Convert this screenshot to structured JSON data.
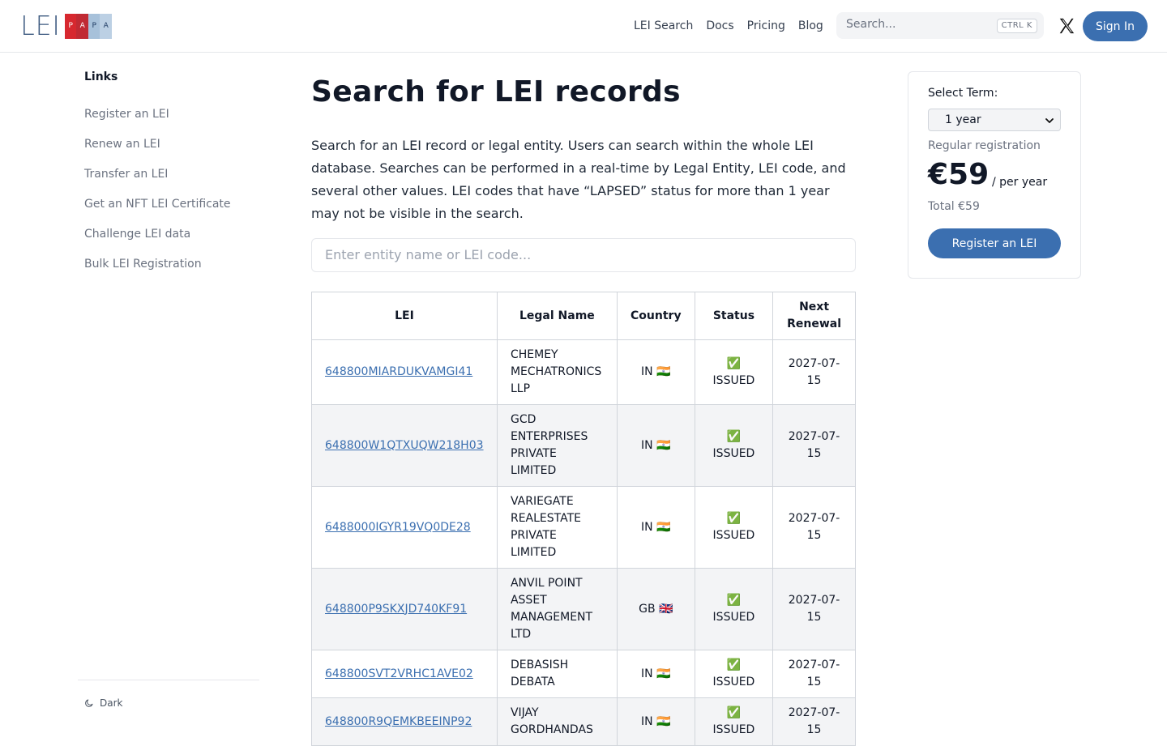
{
  "header": {
    "logo": {
      "text": "LEI",
      "letters": [
        "P",
        "A",
        "P",
        "A"
      ]
    },
    "nav": [
      "LEI Search",
      "Docs",
      "Pricing",
      "Blog"
    ],
    "search": {
      "placeholder": "Search...",
      "shortcut": "CTRL K"
    },
    "signin_label": "Sign In"
  },
  "sidebar": {
    "title": "Links",
    "items": [
      "Register an LEI",
      "Renew an LEI",
      "Transfer an LEI",
      "Get an NFT LEI Certificate",
      "Challenge LEI data",
      "Bulk LEI Registration"
    ],
    "theme_toggle": "Dark"
  },
  "main": {
    "title": "Search for LEI records",
    "intro": "Search for an LEI record or legal entity. Users can search within the whole LEI database. Searches can be performed in a real-time by Legal Entity, LEI code, and several other values. LEI codes that have “LAPSED” status for more than 1 year may not be visible in the search.",
    "entity_search_placeholder": "Enter entity name or LEI code...",
    "table": {
      "headers": [
        "LEI",
        "Legal Name",
        "Country",
        "Status",
        "Next Renewal"
      ],
      "rows": [
        {
          "lei": "648800MIARDUKVAMGI41",
          "name": "CHEMEY MECHATRONICS LLP",
          "country": "IN 🇮🇳",
          "status": "✅ ISSUED",
          "renewal": "2027-07-15"
        },
        {
          "lei": "648800W1QTXUQW218H03",
          "name": "GCD ENTERPRISES PRIVATE LIMITED",
          "country": "IN 🇮🇳",
          "status": "✅ ISSUED",
          "renewal": "2027-07-15"
        },
        {
          "lei": "6488000IGYR19VQ0DE28",
          "name": "VARIEGATE REALESTATE PRIVATE LIMITED",
          "country": "IN 🇮🇳",
          "status": "✅ ISSUED",
          "renewal": "2027-07-15"
        },
        {
          "lei": "648800P9SKXJD740KF91",
          "name": "ANVIL POINT ASSET MANAGEMENT LTD",
          "country": "GB 🇬🇧",
          "status": "✅ ISSUED",
          "renewal": "2027-07-15"
        },
        {
          "lei": "648800SVT2VRHC1AVE02",
          "name": "DEBASISH DEBATA",
          "country": "IN 🇮🇳",
          "status": "✅ ISSUED",
          "renewal": "2027-07-15"
        },
        {
          "lei": "648800R9QEMKBEEINP92",
          "name": "VIJAY GORDHANDAS",
          "country": "IN 🇮🇳",
          "status": "✅ ISSUED",
          "renewal": "2027-07-15"
        }
      ]
    }
  },
  "pricing_panel": {
    "select_label": "Select Term:",
    "term_value": "1 year",
    "registration_type": "Regular registration",
    "price": "€59",
    "per": "/ per year",
    "total": "Total €59",
    "cta": "Register an LEI"
  },
  "colors": {
    "accent": "#3b6fb0",
    "logo_red": "#d7282f",
    "logo_blue": "#3d5a80"
  }
}
